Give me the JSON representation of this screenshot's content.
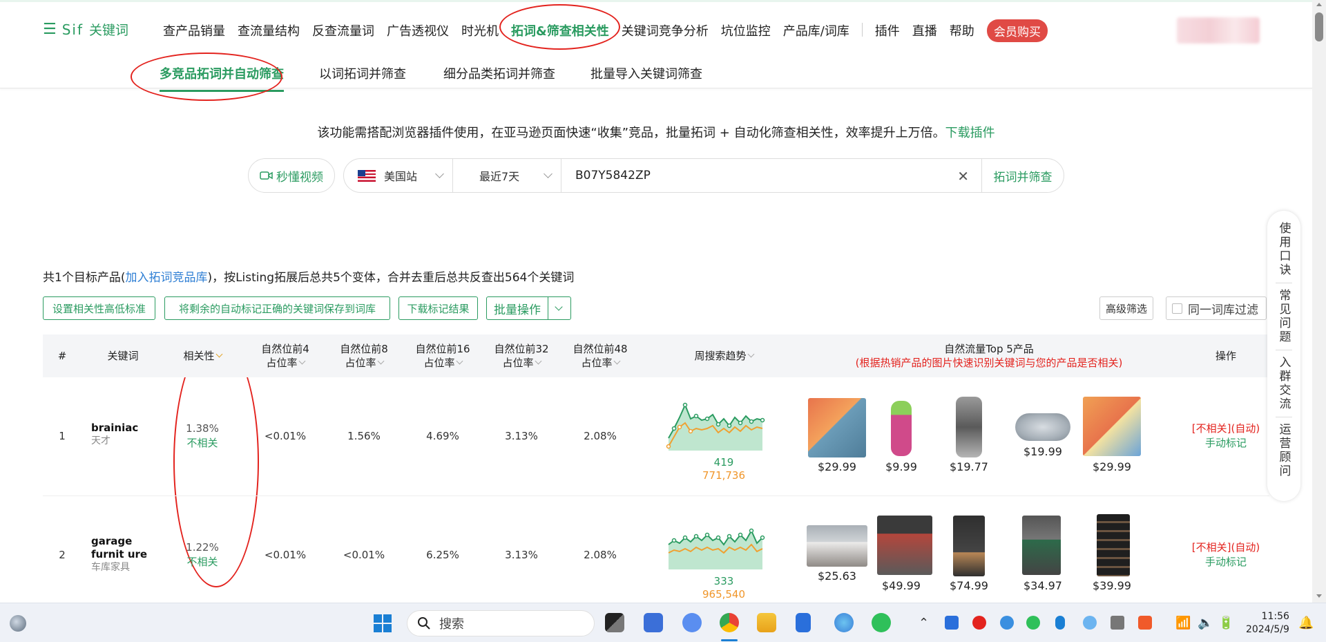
{
  "logo": {
    "brand": "Sif",
    "cn": "关键词"
  },
  "nav": {
    "items": [
      "查产品销量",
      "查流量结构",
      "反查流量词",
      "广告透视仪",
      "时光机",
      "拓词&筛查相关性",
      "关键词竞争分析",
      "坑位监控",
      "产品库/词库"
    ],
    "items2": [
      "插件",
      "直播",
      "帮助"
    ],
    "vip": "会员购买"
  },
  "subnav": [
    "多竞品拓词并自动筛查",
    "以词拓词并筛查",
    "细分品类拓词并筛查",
    "批量导入关键词筛查"
  ],
  "intro": {
    "text": "该功能需搭配浏览器插件使用，在亚马逊页面快速“收集”竞品，批量拓词 + 自动化筛查相关性，效率提升上万倍。",
    "link": "下载插件"
  },
  "search": {
    "video": "秒懂视频",
    "site": "美国站",
    "days": "最近7天",
    "asin": "B07Y5842ZP",
    "go": "拓词并筛查"
  },
  "summary": {
    "pre": "共1个目标产品(",
    "link": "加入拓词竞品库",
    "post": ")，按Listing拓展后总共5个变体，合并去重后总共反查出564个关键词"
  },
  "actions": {
    "b1": "设置相关性高低标准",
    "b2": "将剩余的自动标记正确的关键词保存到词库",
    "b3": "下载标记结果",
    "batch": "批量操作",
    "adv": "高级筛选",
    "samelib": "同一词库过滤"
  },
  "table": {
    "headers": {
      "idx": "#",
      "kw": "关键词",
      "rel": "相关性",
      "p4a": "自然位前4",
      "p4b": "占位率",
      "p8a": "自然位前8",
      "p8b": "占位率",
      "p16a": "自然位前16",
      "p16b": "占位率",
      "p32a": "自然位前32",
      "p32b": "占位率",
      "p48a": "自然位前48",
      "p48b": "占位率",
      "trend": "周搜索趋势",
      "top5": "自然流量Top 5产品",
      "top5sub": "(根据热销产品的图片快速识别关键词与您的产品是否相关)",
      "ops": "操作"
    },
    "rows": [
      {
        "idx": "1",
        "kw": "brainiac",
        "kwcn": "天才",
        "rel": "1.38%",
        "reltag": "不相关",
        "p4": "<0.01%",
        "p8": "1.56%",
        "p16": "4.69%",
        "p32": "3.13%",
        "p48": "2.08%",
        "t1": "419",
        "t2": "771,736",
        "prices": [
          "$29.99",
          "$9.99",
          "$19.77",
          "$19.99",
          "$29.99"
        ],
        "op1": "[不相关](自动)",
        "op2": "手动标记"
      },
      {
        "idx": "2",
        "kw": "garage furnit ure",
        "kwcn": "车库家具",
        "rel": "1.22%",
        "reltag": "不相关",
        "p4": "<0.01%",
        "p8": "<0.01%",
        "p16": "6.25%",
        "p32": "3.13%",
        "p48": "2.08%",
        "t1": "333",
        "t2": "965,540",
        "prices": [
          "$25.63",
          "$49.99",
          "$74.99",
          "$34.97",
          "$39.99"
        ],
        "op1": "[不相关](自动)",
        "op2": "手动标记"
      }
    ]
  },
  "floatbar": [
    "使用口诀",
    "常见问题",
    "入群交流",
    "运营顾问"
  ],
  "taskbar": {
    "search": "搜索",
    "time": "11:56",
    "date": "2024/5/9"
  },
  "colors": {
    "accent": "#2a9b60",
    "annotation": "#e3231e",
    "vip": "#e04a45"
  }
}
